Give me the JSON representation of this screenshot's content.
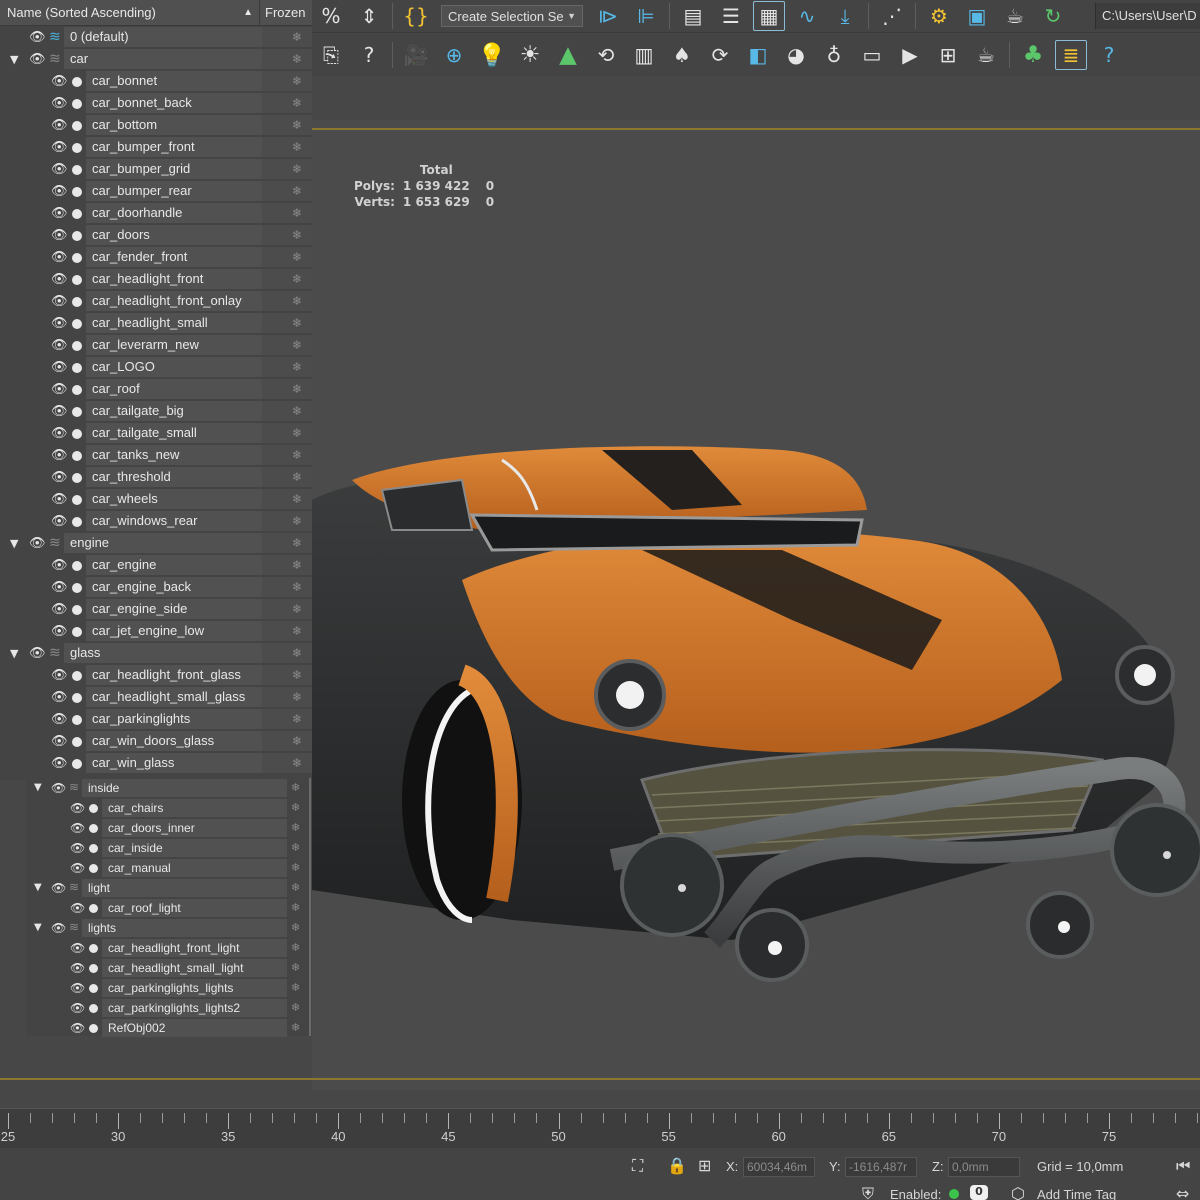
{
  "explorer": {
    "header": {
      "name_label": "Name (Sorted Ascending)",
      "frozen_label": "Frozen"
    },
    "rows": [
      {
        "label": "0 (default)",
        "type": "layer",
        "expanded": false
      },
      {
        "label": "car",
        "type": "layer",
        "expanded": true
      },
      {
        "label": "car_bonnet",
        "type": "object"
      },
      {
        "label": "car_bonnet_back",
        "type": "object"
      },
      {
        "label": "car_bottom",
        "type": "object"
      },
      {
        "label": "car_bumper_front",
        "type": "object"
      },
      {
        "label": "car_bumper_grid",
        "type": "object"
      },
      {
        "label": "car_bumper_rear",
        "type": "object"
      },
      {
        "label": "car_doorhandle",
        "type": "object"
      },
      {
        "label": "car_doors",
        "type": "object"
      },
      {
        "label": "car_fender_front",
        "type": "object"
      },
      {
        "label": "car_headlight_front",
        "type": "object"
      },
      {
        "label": "car_headlight_front_onlay",
        "type": "object"
      },
      {
        "label": "car_headlight_small",
        "type": "object"
      },
      {
        "label": "car_leverarm_new",
        "type": "object"
      },
      {
        "label": "car_LOGO",
        "type": "object"
      },
      {
        "label": "car_roof",
        "type": "object"
      },
      {
        "label": "car_tailgate_big",
        "type": "object"
      },
      {
        "label": "car_tailgate_small",
        "type": "object"
      },
      {
        "label": "car_tanks_new",
        "type": "object"
      },
      {
        "label": "car_threshold",
        "type": "object"
      },
      {
        "label": "car_wheels",
        "type": "object"
      },
      {
        "label": "car_windows_rear",
        "type": "object"
      },
      {
        "label": "engine",
        "type": "layer",
        "expanded": true
      },
      {
        "label": "car_engine",
        "type": "object"
      },
      {
        "label": "car_engine_back",
        "type": "object"
      },
      {
        "label": "car_engine_side",
        "type": "object"
      },
      {
        "label": "car_jet_engine_low",
        "type": "object"
      },
      {
        "label": "glass",
        "type": "layer",
        "expanded": true
      },
      {
        "label": "car_headlight_front_glass",
        "type": "object"
      },
      {
        "label": "car_headlight_small_glass",
        "type": "object"
      },
      {
        "label": "car_parkinglights",
        "type": "object"
      },
      {
        "label": "car_win_doors_glass",
        "type": "object"
      },
      {
        "label": "car_win_glass",
        "type": "object"
      }
    ],
    "subrows": [
      {
        "label": "inside",
        "type": "layer"
      },
      {
        "label": "car_chairs",
        "type": "object"
      },
      {
        "label": "car_doors_inner",
        "type": "object"
      },
      {
        "label": "car_inside",
        "type": "object"
      },
      {
        "label": "car_manual",
        "type": "object"
      },
      {
        "label": "light",
        "type": "layer"
      },
      {
        "label": "car_roof_light",
        "type": "object"
      },
      {
        "label": "lights",
        "type": "layer"
      },
      {
        "label": "car_headlight_front_light",
        "type": "object"
      },
      {
        "label": "car_headlight_small_light",
        "type": "object"
      },
      {
        "label": "car_parkinglights_lights",
        "type": "object"
      },
      {
        "label": "car_parkinglights_lights2",
        "type": "object"
      },
      {
        "label": "RefObj002",
        "type": "object"
      }
    ]
  },
  "toolbar": {
    "selection_set": "Create Selection Se",
    "path": "C:\\Users\\User\\D",
    "row1_icons": [
      "snap-percent-icon",
      "spinner-snap-icon",
      "named-selection-edit-icon",
      "mirror-icon",
      "align-icon",
      "scene-explorer-icon",
      "layer-manager-icon",
      "ribbon-icon",
      "curve-editor-icon",
      "dope-sheet-icon",
      "schematic-view-icon",
      "render-setup-icon",
      "rendered-frame-icon",
      "render-icon",
      "render-iterative-icon"
    ],
    "row2_icons": [
      "import-icon",
      "help-icon",
      "camera-icon",
      "camera-add-icon",
      "light-bulb-icon",
      "sun-icon",
      "tree-icon",
      "rotate-view-icon",
      "document-icon",
      "tree-doc-icon",
      "refresh-icon",
      "cube-frame-icon",
      "palette-icon",
      "lamp-icon",
      "box-icon",
      "media-icon",
      "viewport-icon",
      "teapot-icon",
      "forest-icon",
      "list-icon",
      "help-circle-icon"
    ]
  },
  "viewport": {
    "stats": {
      "total_header": "Total",
      "polys_label": "Polys:",
      "polys_value": "1 639 422",
      "polys_sel": "0",
      "verts_label": "Verts:",
      "verts_value": "1 653 629",
      "verts_sel": "0"
    }
  },
  "timeline": {
    "labels": [
      "25",
      "30",
      "35",
      "40",
      "45",
      "50",
      "55",
      "60",
      "65",
      "70",
      "75"
    ]
  },
  "statusbar": {
    "x_label": "X:",
    "x_value": "60034,46m",
    "y_label": "Y:",
    "y_value": "-1616,487r",
    "z_label": "Z:",
    "z_value": "0,0mm",
    "grid": "Grid = 10,0mm",
    "enabled_label": "Enabled:",
    "enabled_value": "0",
    "add_time_tag": "Add Time Tag"
  },
  "colors": {
    "accent_blue": "#58b8e6",
    "viewport_border": "#8b7a2e",
    "car_orange": "#d4782a",
    "car_dark": "#2b2d2e"
  }
}
